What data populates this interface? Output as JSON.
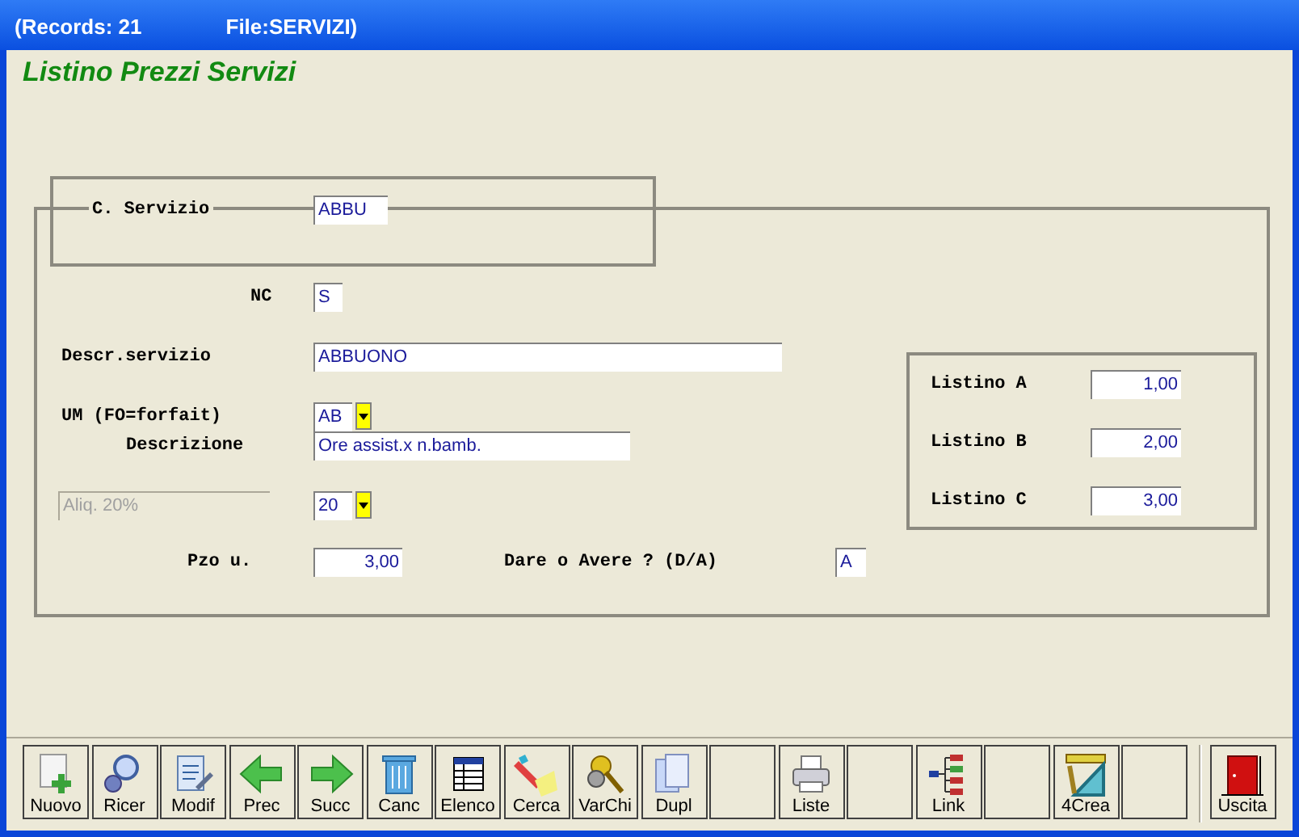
{
  "window": {
    "title": "(Records: 21",
    "file": "File:SERVIZI)"
  },
  "form_title": "Listino Prezzi Servizi",
  "fields": [
    {
      "label": "C. Servizio",
      "value": "ABBU",
      "kind": "text"
    },
    {
      "label": "NC",
      "value": "S",
      "kind": "text"
    },
    {
      "label": "Descr.servizio",
      "value": "ABBUONO",
      "kind": "text"
    },
    {
      "label": "UM (FO=forfait)",
      "value": "AB",
      "kind": "combo"
    },
    {
      "label": "Descrizione",
      "value": "Ore assist.x n.bamb.",
      "kind": "text"
    },
    {
      "value": "Aliq. 20%",
      "kind": "disabled"
    },
    {
      "value": "20",
      "kind": "combo"
    },
    {
      "label": "Pzo u.",
      "value": "3,00",
      "kind": "number"
    },
    {
      "label": "Dare o Avere ? (D/A)",
      "value": "A",
      "kind": "text"
    }
  ],
  "price_lists": [
    {
      "label": "Listino A",
      "value": "1,00"
    },
    {
      "label": "Listino B",
      "value": "2,00"
    },
    {
      "label": "Listino C",
      "value": "3,00"
    }
  ],
  "toolbar": [
    {
      "label": "Nuovo",
      "kind": "new"
    },
    {
      "label": "Ricer",
      "kind": "search"
    },
    {
      "label": "Modif",
      "kind": "edit"
    },
    {
      "label": "Prec",
      "kind": "prev"
    },
    {
      "label": "Succ",
      "kind": "next"
    },
    {
      "label": "Canc",
      "kind": "delete"
    },
    {
      "label": "Elenco",
      "kind": "list"
    },
    {
      "label": "Cerca",
      "kind": "find"
    },
    {
      "label": "VarChi",
      "kind": "keys"
    },
    {
      "label": "Dupl",
      "kind": "copy"
    },
    {
      "kind": "blank"
    },
    {
      "label": "Liste",
      "kind": "print"
    },
    {
      "kind": "blank"
    },
    {
      "label": "Link",
      "kind": "link"
    },
    {
      "kind": "blank"
    },
    {
      "label": "4Crea",
      "kind": "tools"
    },
    {
      "kind": "blank"
    },
    {
      "label": "Uscita",
      "kind": "exit"
    }
  ]
}
